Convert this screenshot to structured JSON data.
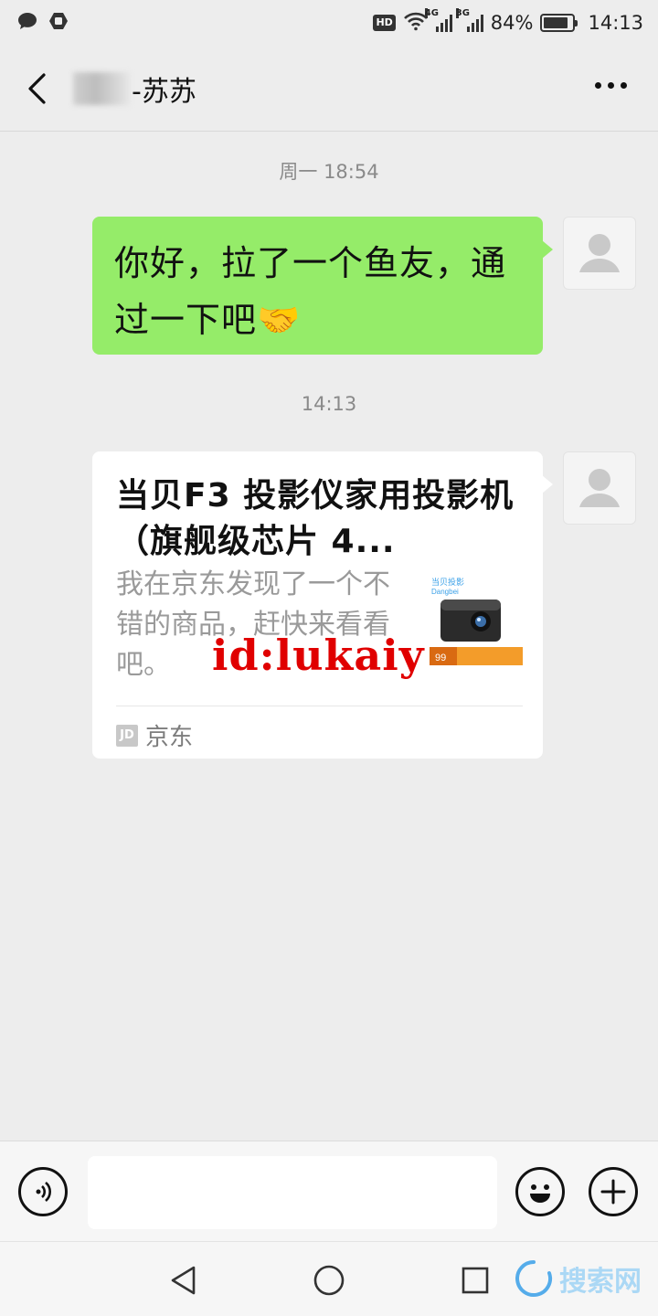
{
  "status_bar": {
    "hd": "HD",
    "net1": "4G",
    "net2": "3G",
    "battery": "84%",
    "battery_level": 0.84,
    "time": "14:13"
  },
  "header": {
    "contact_suffix": "-苏苏"
  },
  "chat": {
    "timestamp_1": "周一 18:54",
    "message_1": "你好，拉了一个鱼友，通过一下吧🤝",
    "timestamp_2": "14:13",
    "card": {
      "title": "当贝F3 投影仪家用投影机（旗舰级芯片 4...",
      "description": "我在京东发现了一个不错的商品，赶快来看看吧。",
      "thumb_brand": "当贝投影",
      "thumb_sub": "Dangbei",
      "thumb_price": "99",
      "source_logo": "JD",
      "source": "京东"
    }
  },
  "watermark": "id:lukaiy",
  "site_mark": "搜索网",
  "colors": {
    "background": "#ededed",
    "sent_bubble": "#95ec69",
    "card_bubble": "#ffffff",
    "watermark": "#e00000"
  }
}
